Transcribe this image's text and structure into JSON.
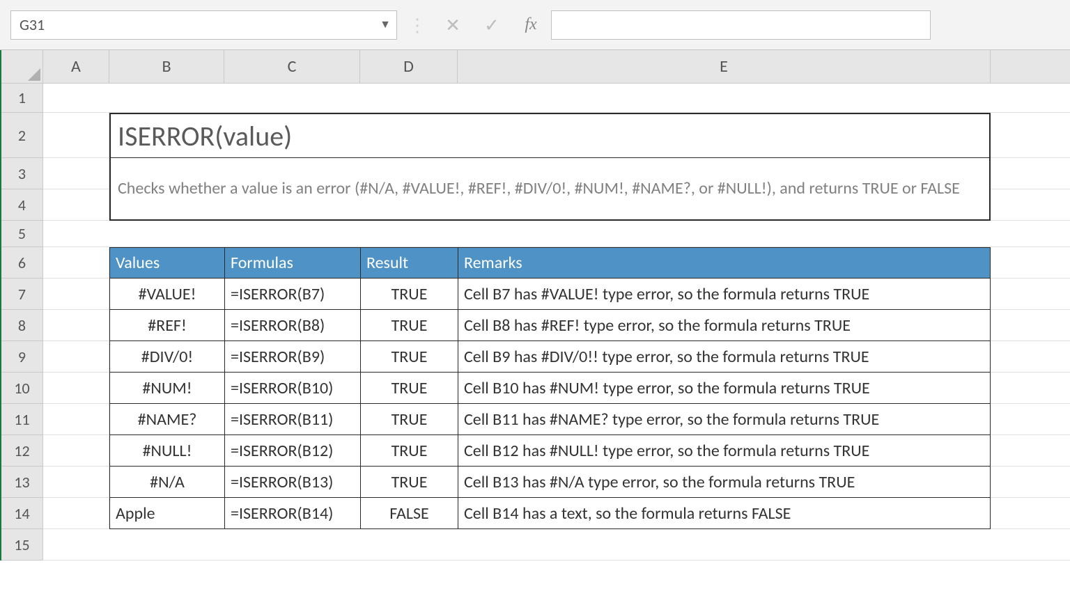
{
  "nameBox": "G31",
  "formulaValue": "",
  "columns": [
    "A",
    "B",
    "C",
    "D",
    "E"
  ],
  "rows": [
    "1",
    "2",
    "3",
    "4",
    "5",
    "6",
    "7",
    "8",
    "9",
    "10",
    "11",
    "12",
    "13",
    "14",
    "15"
  ],
  "title": "ISERROR(value)",
  "description": "Checks whether a value is an error (#N/A, #VALUE!, #REF!, #DIV/0!, #NUM!, #NAME?, or #NULL!), and returns TRUE or FALSE",
  "table": {
    "headers": {
      "values": "Values",
      "formulas": "Formulas",
      "result": "Result",
      "remarks": "Remarks"
    },
    "rows": [
      {
        "value": "#VALUE!",
        "formula": "=ISERROR(B7)",
        "result": "TRUE",
        "remark": "Cell B7 has #VALUE! type error, so the formula returns TRUE"
      },
      {
        "value": "#REF!",
        "formula": "=ISERROR(B8)",
        "result": "TRUE",
        "remark": "Cell B8 has #REF! type error, so the formula returns TRUE"
      },
      {
        "value": "#DIV/0!",
        "formula": "=ISERROR(B9)",
        "result": "TRUE",
        "remark": "Cell B9 has #DIV/0!! type error, so the formula returns TRUE"
      },
      {
        "value": "#NUM!",
        "formula": "=ISERROR(B10)",
        "result": "TRUE",
        "remark": "Cell B10 has #NUM! type error, so the formula returns TRUE"
      },
      {
        "value": "#NAME?",
        "formula": "=ISERROR(B11)",
        "result": "TRUE",
        "remark": "Cell B11 has #NAME? type error, so the formula returns TRUE"
      },
      {
        "value": "#NULL!",
        "formula": "=ISERROR(B12)",
        "result": "TRUE",
        "remark": "Cell B12 has #NULL! type error, so the formula returns TRUE"
      },
      {
        "value": "#N/A",
        "formula": "=ISERROR(B13)",
        "result": "TRUE",
        "remark": "Cell B13 has #N/A type error, so the formula returns TRUE"
      },
      {
        "value": "Apple",
        "formula": "=ISERROR(B14)",
        "result": "FALSE",
        "remark": "Cell B14 has a text, so the formula returns FALSE"
      }
    ]
  },
  "icons": {
    "cancel": "✕",
    "enter": "✓",
    "fx": "fx",
    "dropdown": "▼",
    "dots": "⋮"
  }
}
